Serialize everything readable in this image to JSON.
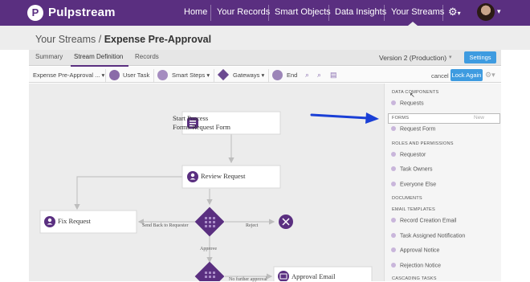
{
  "nav": {
    "brand": "Pulpstream",
    "logo_letter": "P",
    "items": [
      "Home",
      "Your Records",
      "Smart Objects",
      "Data Insights",
      "Your Streams"
    ],
    "gear_caret": "▾"
  },
  "breadcrumb": {
    "parent": "Your Streams /",
    "current": "Expense Pre-Approval"
  },
  "tabs": [
    "Summary",
    "Stream Definition",
    "Records"
  ],
  "version_label": "Version 2 (Production)",
  "settings_label": "Settings",
  "toolbar": {
    "form_select": "Expense Pre-Approval ...",
    "user_task": "User Task",
    "smart_steps": "Smart Steps",
    "gateways": "Gateways",
    "end": "End",
    "cancel": "cancel",
    "lock_again": "Lock Again"
  },
  "diagram": {
    "start_line1": "Start Process",
    "start_line2": "Forms:Request Form",
    "review": "Review Request",
    "fix": "Fix Request",
    "send_back": "Send Back to Requester",
    "reject": "Reject",
    "approve": "Approve",
    "approval_email": "Approval Email",
    "no_further": "No further approval"
  },
  "sidebar": {
    "data_components": "DATA COMPONENTS",
    "requests": "Requests",
    "forms": "FORMS",
    "forms_new": "New",
    "request_form": "Request Form",
    "roles": "ROLES AND PERMISSIONS",
    "requestor": "Requestor",
    "task_owners": "Task Owners",
    "everyone_else": "Everyone Else",
    "documents": "DOCUMENTS",
    "email_templates": "EMAIL TEMPLATES",
    "record_creation": "Record Creation Email",
    "task_assigned": "Task Assigned Notification",
    "approval_notice": "Approval Notice",
    "rejection_notice": "Rejection Notice",
    "cascading": "CASCADING TASKS"
  },
  "colors": {
    "brand_purple": "#5a2f80",
    "button_blue": "#3e9be0",
    "arrow_blue": "#1a3fd6"
  }
}
